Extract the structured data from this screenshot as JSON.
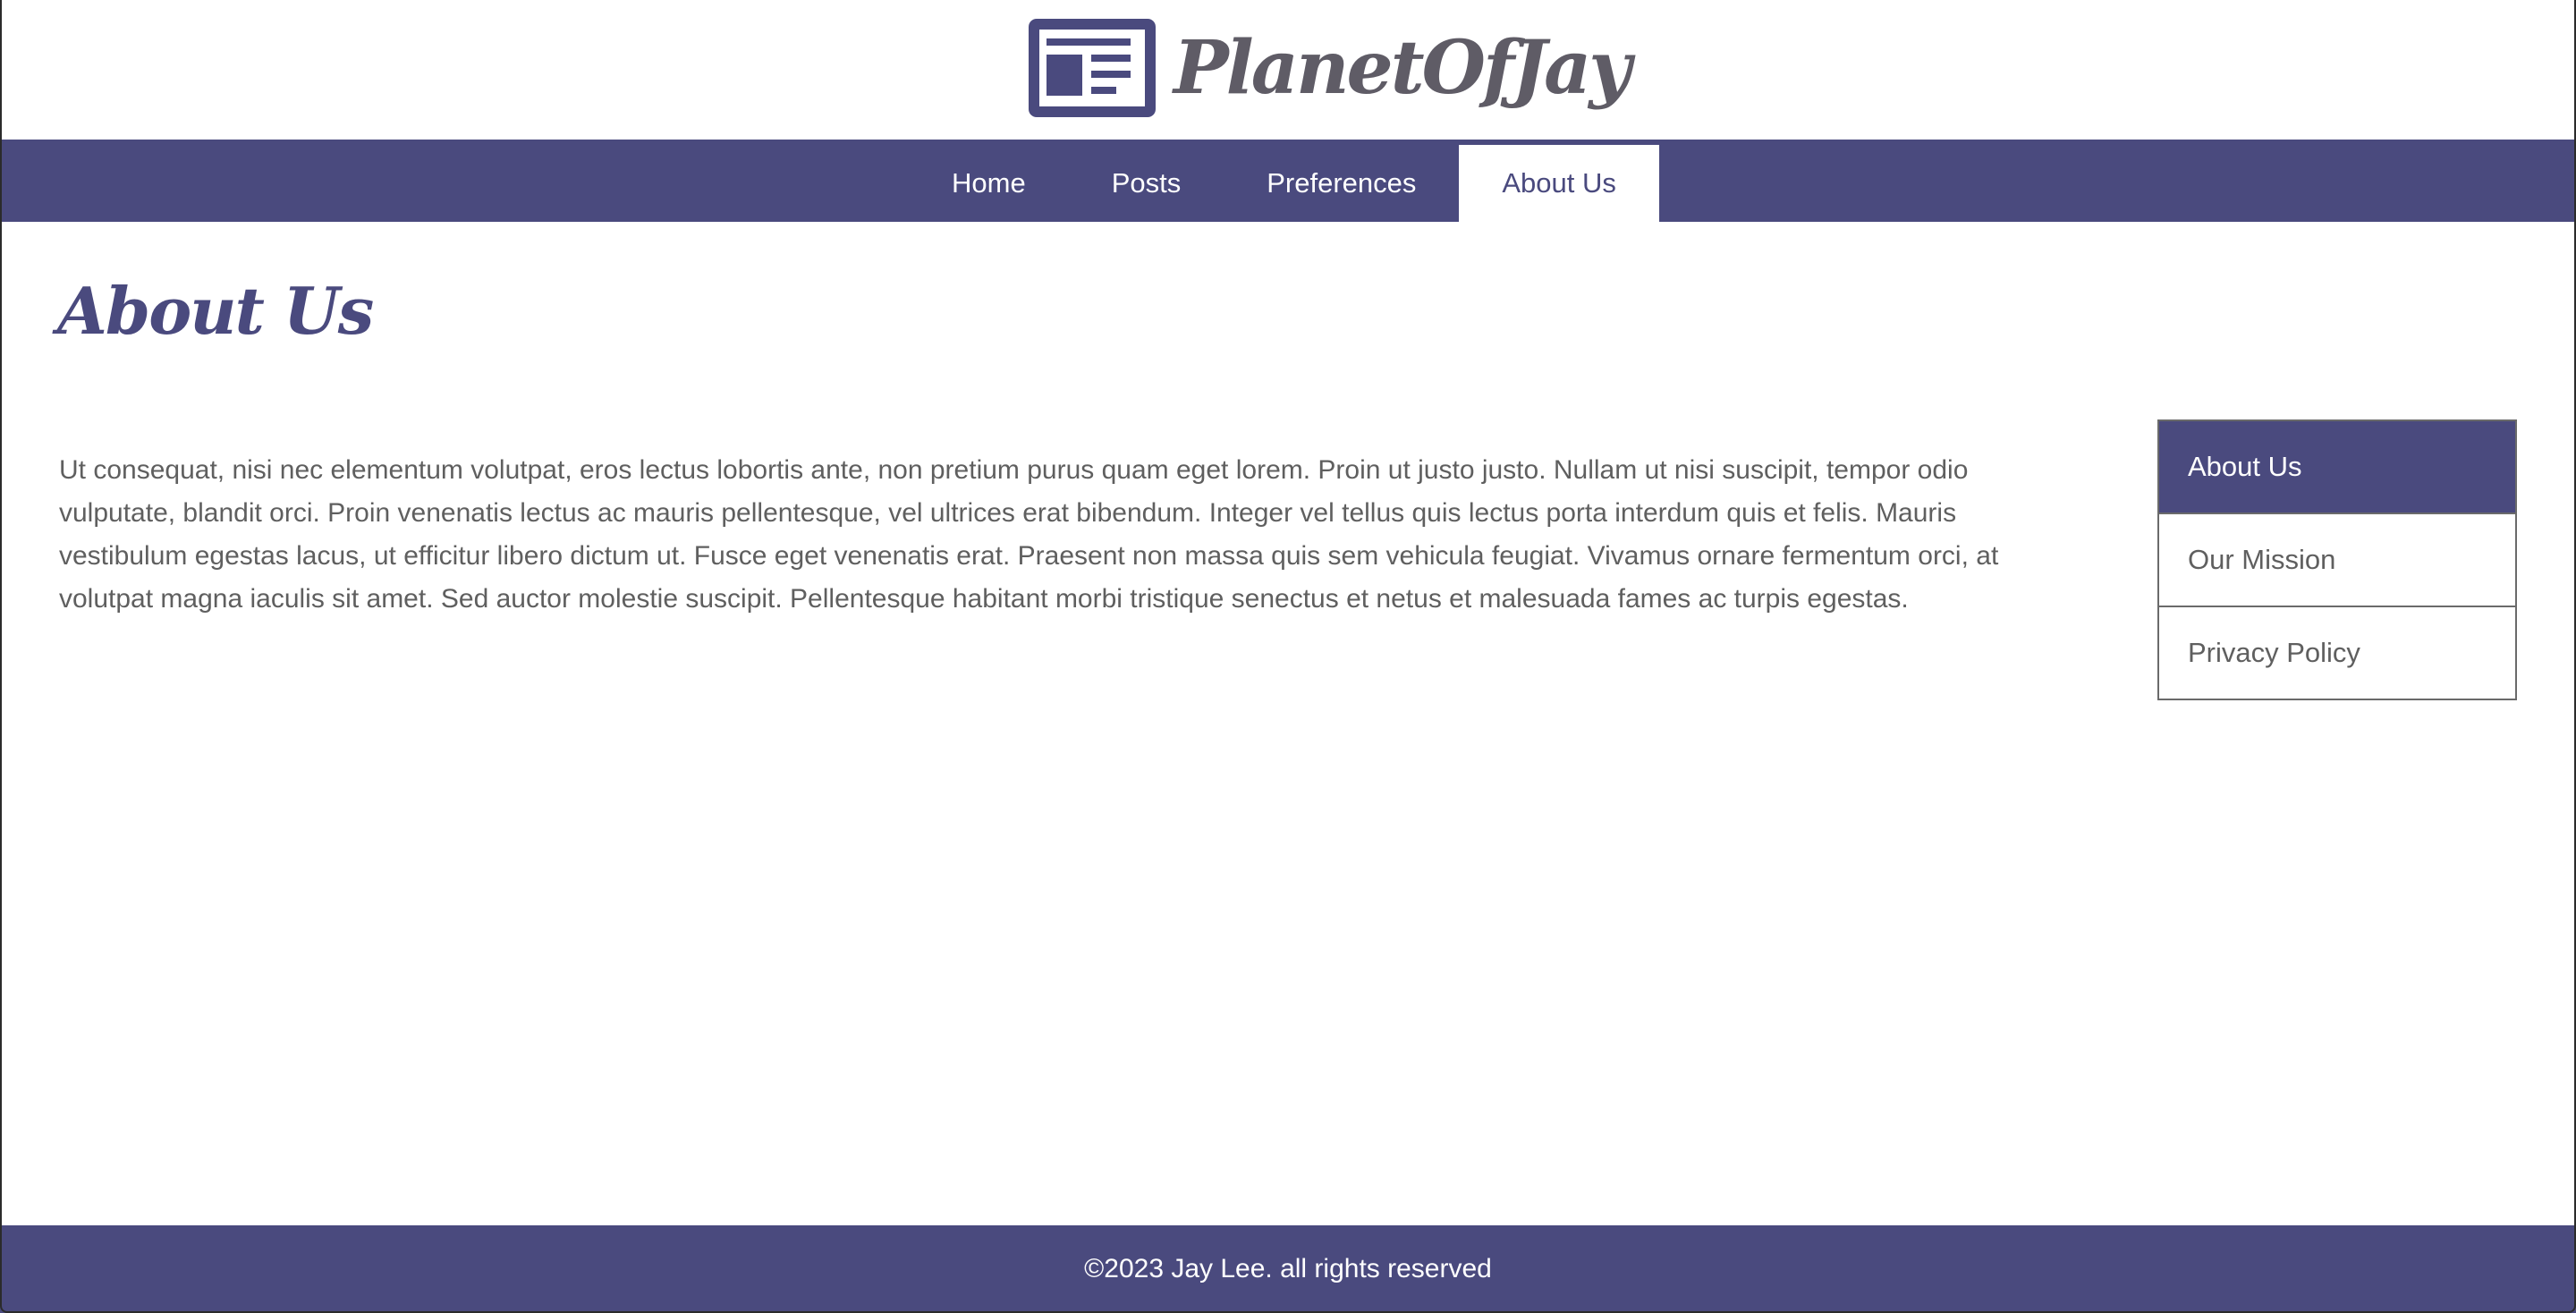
{
  "header": {
    "logo_text": "PlanetOfJay",
    "logo_icon": "newspaper-icon"
  },
  "nav": {
    "items": [
      {
        "label": "Home",
        "active": false
      },
      {
        "label": "Posts",
        "active": false
      },
      {
        "label": "Preferences",
        "active": false
      },
      {
        "label": "About Us",
        "active": true
      }
    ]
  },
  "main": {
    "title": "About Us",
    "body": "Ut consequat, nisi nec elementum volutpat, eros lectus lobortis ante, non pretium purus quam eget lorem. Proin ut justo justo. Nullam ut nisi suscipit, tempor odio vulputate, blandit orci. Proin venenatis lectus ac mauris pellentesque, vel ultrices erat bibendum. Integer vel tellus quis lectus porta interdum quis et felis. Mauris vestibulum egestas lacus, ut efficitur libero dictum ut. Fusce eget venenatis erat. Praesent non massa quis sem vehicula feugiat. Vivamus ornare fermentum orci, at volutpat magna iaculis sit amet. Sed auctor molestie suscipit. Pellentesque habitant morbi tristique senectus et netus et malesuada fames ac turpis egestas."
  },
  "side_menu": {
    "items": [
      {
        "label": "About Us",
        "active": true
      },
      {
        "label": "Our Mission",
        "active": false
      },
      {
        "label": "Privacy Policy",
        "active": false
      }
    ]
  },
  "footer": {
    "text": "©2023 Jay Lee. all rights reserved"
  },
  "colors": {
    "brand": "#4a4a7e",
    "text": "#5f5f5f",
    "logo_text": "#5f5c66",
    "background": "#ffffff"
  }
}
